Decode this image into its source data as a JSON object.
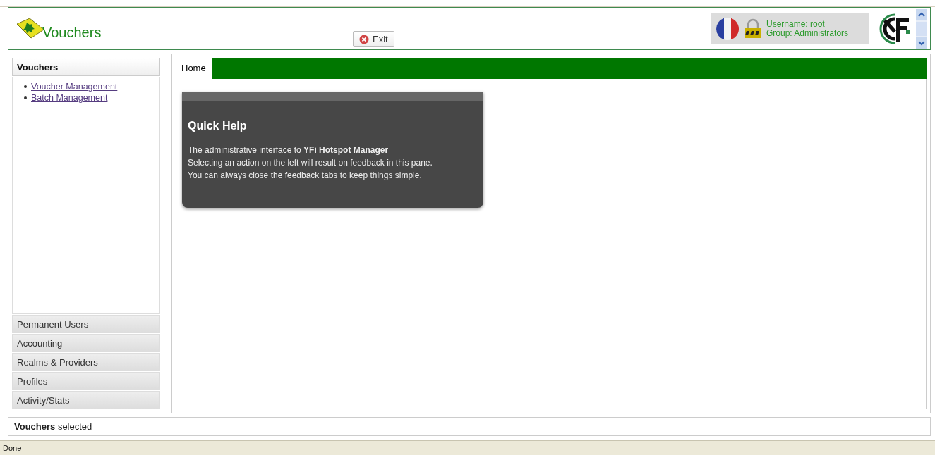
{
  "header": {
    "title": "Vouchers",
    "exit_button": "Exit",
    "user": {
      "username": "Username: root",
      "group": "Group: Administrators"
    }
  },
  "accordion": [
    {
      "title": "Vouchers",
      "expanded": true,
      "links": [
        "Voucher Management",
        "Batch Management"
      ]
    },
    {
      "title": "Permanent Users",
      "expanded": false
    },
    {
      "title": "Accounting",
      "expanded": false
    },
    {
      "title": "Realms & Providers",
      "expanded": false
    },
    {
      "title": "Profiles",
      "expanded": false
    },
    {
      "title": "Activity/Stats",
      "expanded": false
    }
  ],
  "tabs": [
    {
      "label": "Home",
      "selected": true
    }
  ],
  "quick_help": {
    "title": "Quick Help",
    "lines": [
      "The administrative interface to **YFi Hotspot Manager**",
      "Selecting an action on the left will result on feedback in this pane.",
      "You can always close the feedback tabs to keep things simple."
    ]
  },
  "status": "**Vouchers** selected",
  "browser_status": "Done"
}
